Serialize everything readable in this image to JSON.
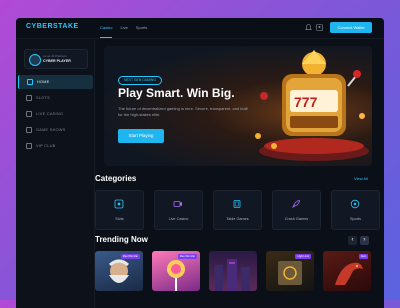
{
  "app": {
    "logo": "CYBERSTAKE"
  },
  "nav": {
    "tabs": [
      "Casino",
      "Live",
      "Sports"
    ],
    "active_index": 0
  },
  "header": {
    "connect_label": "Connect Wallet",
    "bell_icon": "bell-icon",
    "profile_icon": "user-icon"
  },
  "profile": {
    "sub": "Level 42 Platinum",
    "name": "CYBER PLAYER"
  },
  "sidebar": {
    "items": [
      {
        "label": "HOME",
        "active": true
      },
      {
        "label": "SLOTS",
        "active": false
      },
      {
        "label": "LIVE CASINO",
        "active": false
      },
      {
        "label": "GAME SHOWS",
        "active": false
      },
      {
        "label": "VIP CLUB",
        "active": false
      }
    ]
  },
  "hero": {
    "tag": "NEXT GEN GAMING",
    "title": "Play Smart. Win Big.",
    "description": "The future of decentralized gaming is here. Secure, transparent, and built for the high-stakes elite.",
    "cta": "Start Playing"
  },
  "categories": {
    "title": "Categories",
    "view_all": "View All",
    "items": [
      {
        "label": "Slots",
        "icon": "slots-icon",
        "color": "#23c8ff"
      },
      {
        "label": "Live Casino",
        "icon": "video-icon",
        "color": "#b06cff"
      },
      {
        "label": "Table Games",
        "icon": "cards-icon",
        "color": "#23c8ff"
      },
      {
        "label": "Crash Games",
        "icon": "rocket-icon",
        "color": "#b06cff"
      },
      {
        "label": "Sports",
        "icon": "ball-icon",
        "color": "#23c8ff"
      }
    ]
  },
  "trending": {
    "title": "Trending Now",
    "prev_icon": "chevron-left-icon",
    "next_icon": "chevron-right-icon",
    "games": [
      {
        "badge": "Max Win Mar"
      },
      {
        "badge": "Max Win Mar"
      },
      {
        "badge": ""
      },
      {
        "badge": "High Limit"
      },
      {
        "badge": "New"
      }
    ]
  },
  "colors": {
    "accent": "#23c8ff",
    "bg": "#0b1018",
    "purple": "#7a3df0"
  }
}
